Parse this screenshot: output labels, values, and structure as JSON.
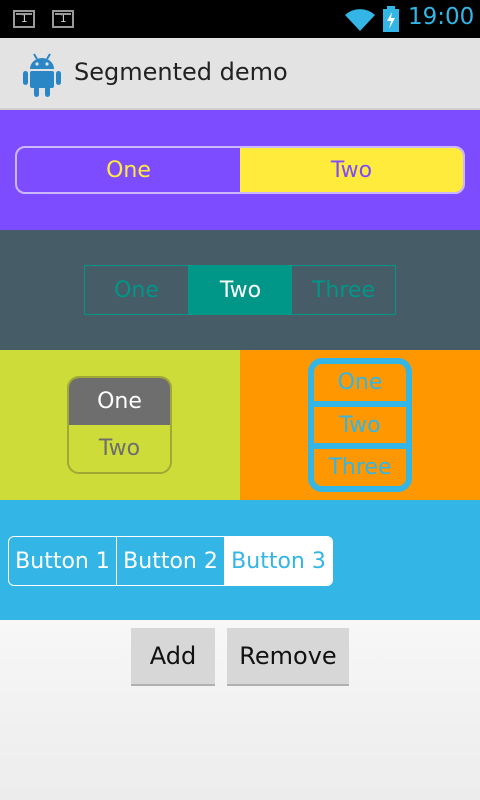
{
  "status_bar": {
    "notifications": [
      "1",
      "1"
    ],
    "time": "19:00"
  },
  "action_bar": {
    "title": "Segmented demo",
    "icon": "android-icon"
  },
  "segments": {
    "purple": {
      "items": [
        "One",
        "Two"
      ],
      "selected": "Two"
    },
    "slate": {
      "items": [
        "One",
        "Two",
        "Three"
      ],
      "selected": "Two"
    },
    "lime": {
      "items": [
        "One",
        "Two"
      ],
      "selected": "One"
    },
    "orange": {
      "items": [
        "One",
        "Two",
        "Three"
      ]
    },
    "blue": {
      "items": [
        "Button 1",
        "Button 2",
        "Button 3"
      ],
      "selected": "Button 3"
    }
  },
  "buttons": {
    "add": "Add",
    "remove": "Remove"
  },
  "colors": {
    "purple_bg": "#7e4cff",
    "yellow": "#ffeb3b",
    "slate_bg": "#465c66",
    "teal": "#009688",
    "lime_bg": "#cddc39",
    "orange_bg": "#ff9800",
    "holo_blue": "#33b5e5"
  }
}
